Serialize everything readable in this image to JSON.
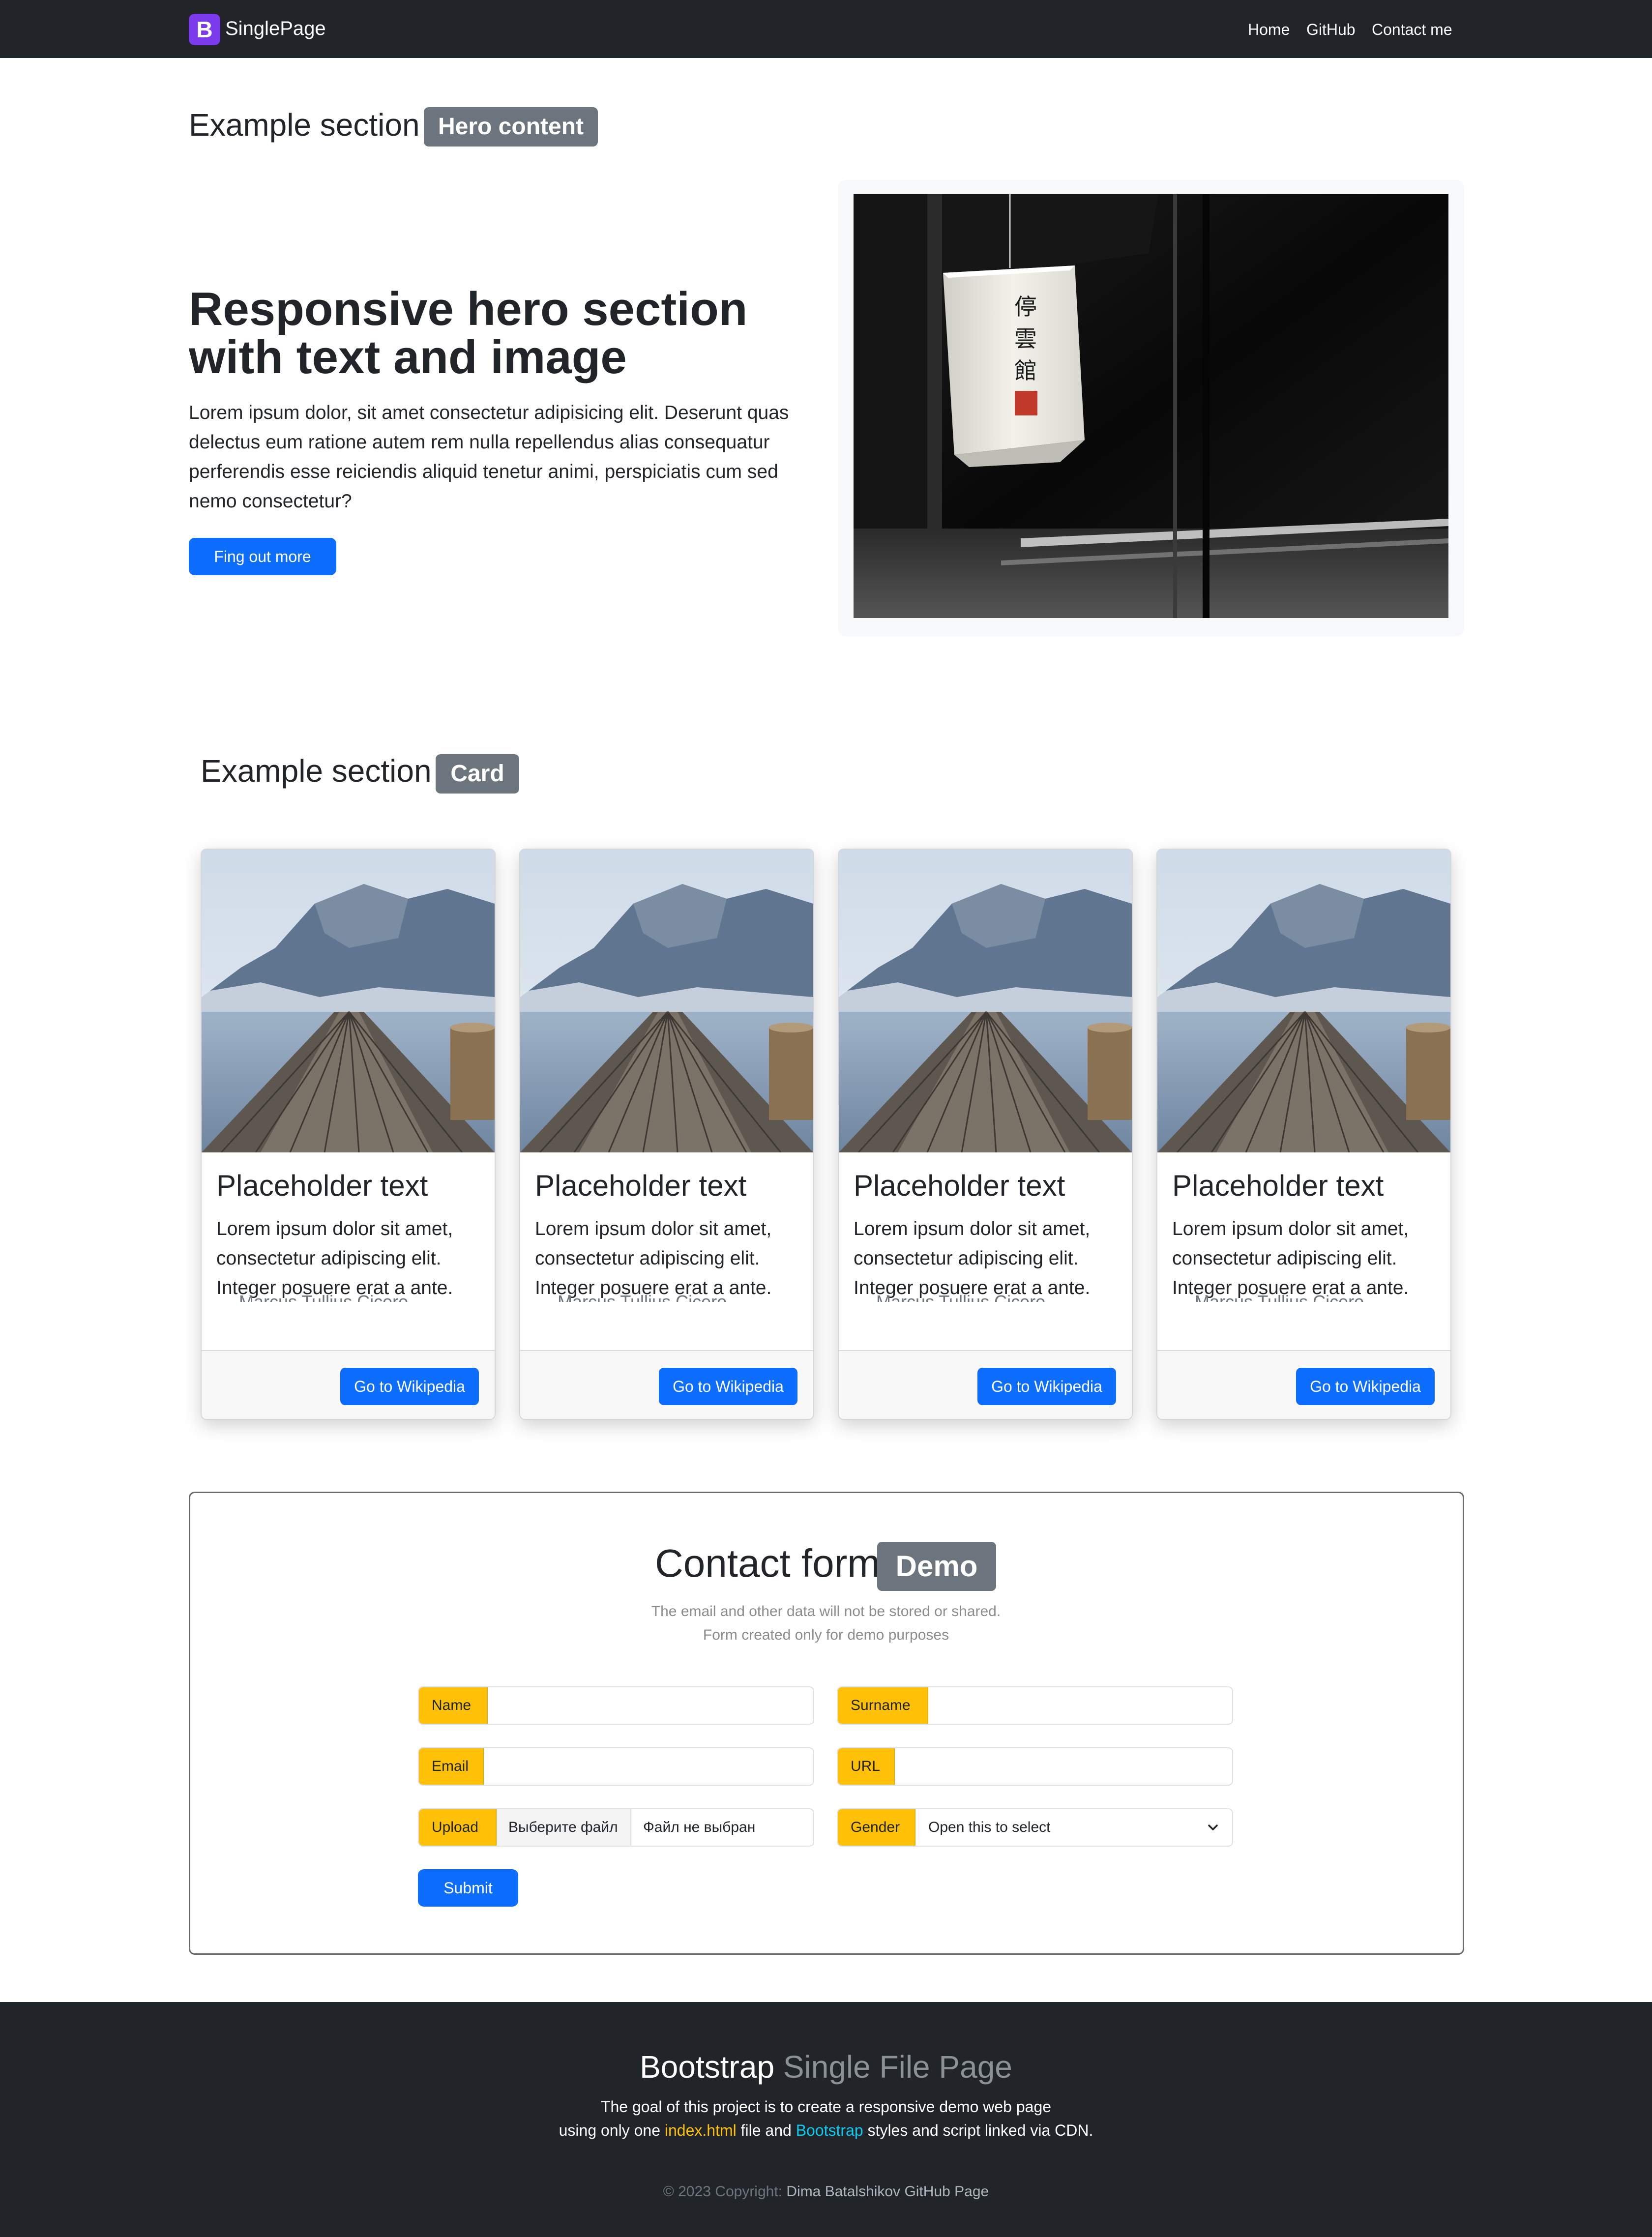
{
  "navbar": {
    "logo_letter": "B",
    "brand": "SinglePage",
    "links": [
      "Home",
      "GitHub",
      "Contact me"
    ]
  },
  "hero_section": {
    "title": "Example section",
    "badge": "Hero content",
    "heading": "Responsive hero section with text and image",
    "text": "Lorem ipsum dolor, sit amet consectetur adipisicing elit. Deserunt quas delectus eum ratione autem rem nulla repellendus alias consequatur perferendis esse reiciendis aliquid tenetur animi, perspiciatis cum sed nemo consectetur?",
    "button": "Fing out more",
    "image_alt": "paper lantern photo"
  },
  "card_section": {
    "title": "Example section",
    "badge": "Card",
    "cards": [
      {
        "title": "Placeholder text",
        "text": "Lorem ipsum dolor sit amet, consectetur adipiscing elit. Integer posuere erat a ante.",
        "cite": "— Marcus Tullius Cicero",
        "button": "Go to Wikipedia"
      },
      {
        "title": "Placeholder text",
        "text": "Lorem ipsum dolor sit amet, consectetur adipiscing elit. Integer posuere erat a ante.",
        "cite": "— Marcus Tullius Cicero",
        "button": "Go to Wikipedia"
      },
      {
        "title": "Placeholder text",
        "text": "Lorem ipsum dolor sit amet, consectetur adipiscing elit. Integer posuere erat a ante.",
        "cite": "— Marcus Tullius Cicero",
        "button": "Go to Wikipedia"
      },
      {
        "title": "Placeholder text",
        "text": "Lorem ipsum dolor sit amet, consectetur adipiscing elit. Integer posuere erat a ante.",
        "cite": "— Marcus Tullius Cicero",
        "button": "Go to Wikipedia"
      }
    ]
  },
  "contact_form": {
    "title": "Contact form",
    "badge": "Demo",
    "note_line1": "The email and other data will not be stored or shared.",
    "note_line2": "Form created only for demo purposes",
    "name_label": "Name",
    "name_value": "",
    "surname_label": "Surname",
    "surname_value": "",
    "email_label": "Email",
    "email_value": "",
    "url_label": "URL",
    "url_value": "",
    "upload_label": "Upload",
    "upload_button": "Выберите файл",
    "upload_status": "Файл не выбран",
    "gender_label": "Gender",
    "gender_selected": "Open this to select",
    "submit": "Submit"
  },
  "footer": {
    "title_main": "Bootstrap",
    "title_muted": "Single File Page",
    "line1": "The goal of this project is to create a responsive demo web page",
    "line2_a": "using only one",
    "line2_file": "index.html",
    "line2_b": "file and",
    "line2_link": "Bootstrap",
    "line2_c": "styles and script linked via CDN.",
    "copyright": "© 2023 Copyright:",
    "copyright_link": "Dima Batalshikov GitHub Page"
  },
  "colors": {
    "navbar_bg": "#212529",
    "primary": "#0d6efd",
    "badge_bg": "#6c757d",
    "addon_warning": "#ffc107",
    "brand_logo": "#7c3aed",
    "link_cyan": "#0dcaf0"
  }
}
